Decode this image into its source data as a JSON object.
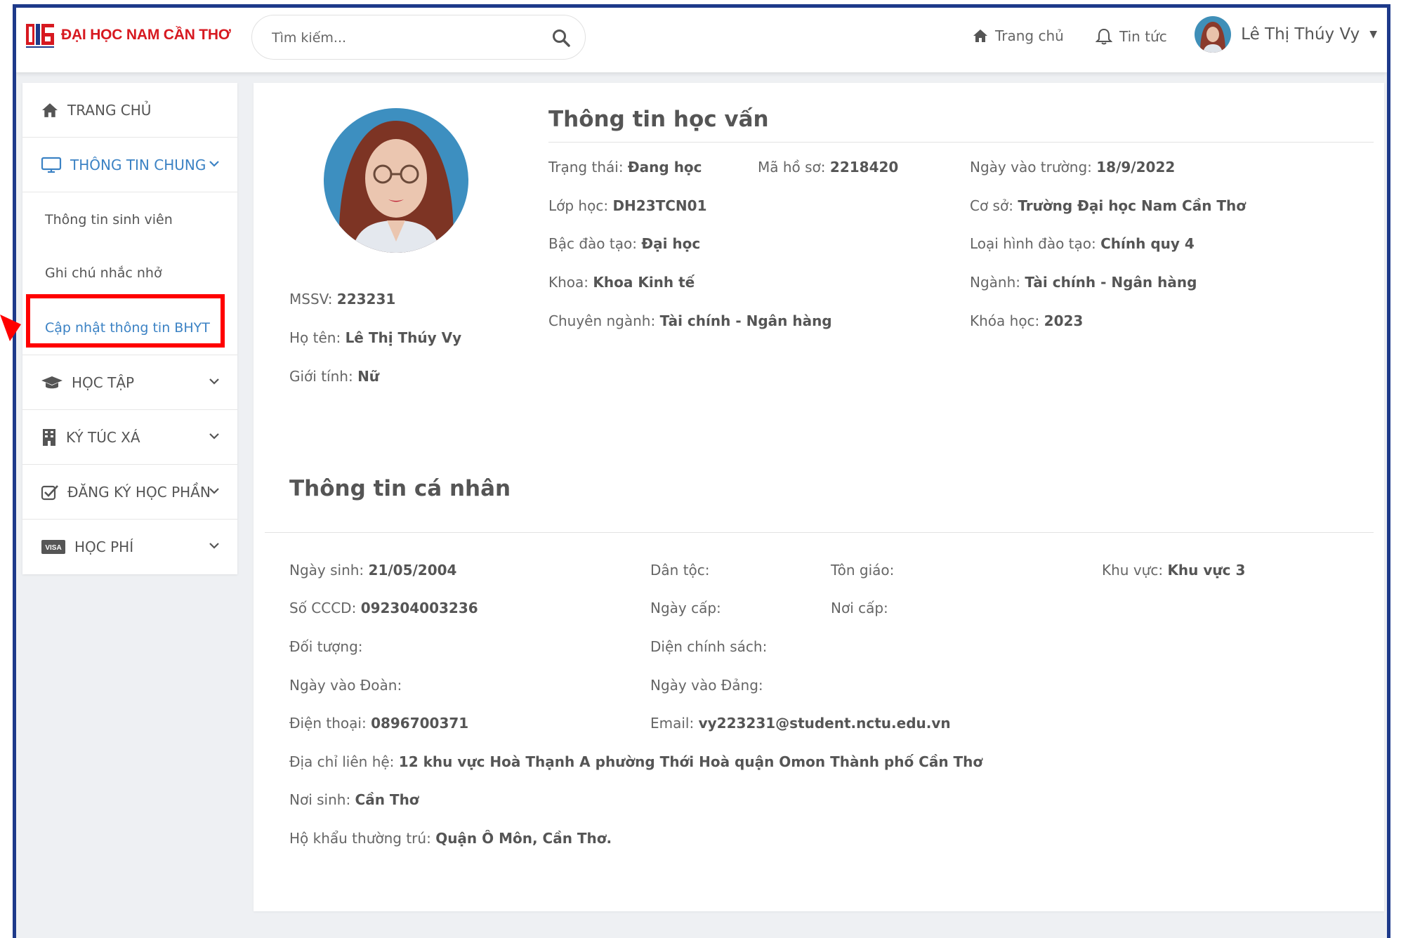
{
  "header": {
    "logo_text": "ĐẠI HỌC NAM CẦN THƠ",
    "search_placeholder": "Tìm kiếm...",
    "nav_home": "Trang chủ",
    "nav_news": "Tin tức",
    "user_name": "Lê Thị Thúy Vy"
  },
  "sidebar": {
    "home": "TRANG CHỦ",
    "general": "THÔNG TIN CHUNG",
    "sub_student_info": "Thông tin sinh viên",
    "sub_notes": "Ghi chú nhắc nhở",
    "sub_bhyt": "Cập nhật thông tin BHYT",
    "study": "HỌC TẬP",
    "dorm": "KÝ TÚC XÁ",
    "registration": "ĐĂNG KÝ HỌC PHẦN",
    "fees": "HỌC PHÍ"
  },
  "academic": {
    "title": "Thông tin học vấn",
    "status_label": "Trạng thái:",
    "status": "Đang học",
    "record_label": "Mã hồ sơ:",
    "record": "2218420",
    "enroll_label": "Ngày vào trường:",
    "enroll": "18/9/2022",
    "class_label": "Lớp học:",
    "class": "DH23TCN01",
    "campus_label": "Cơ sở:",
    "campus": "Trường Đại học Nam Cần Thơ",
    "level_label": "Bậc đào tạo:",
    "level": "Đại học",
    "type_label": "Loại hình đào tạo:",
    "type": "Chính quy 4",
    "faculty_label": "Khoa:",
    "faculty": "Khoa Kinh tế",
    "major_label": "Ngành:",
    "major": "Tài chính - Ngân hàng",
    "spec_label": "Chuyên ngành:",
    "spec": "Tài chính - Ngân hàng",
    "course_label": "Khóa học:",
    "course": "2023",
    "mssv_label": "MSSV:",
    "mssv": "223231",
    "name_label": "Họ tên:",
    "name": "Lê Thị Thúy Vy",
    "gender_label": "Giới tính:",
    "gender": "Nữ"
  },
  "personal": {
    "title": "Thông tin cá nhân",
    "dob_label": "Ngày sinh:",
    "dob": "21/05/2004",
    "ethnic_label": "Dân tộc:",
    "religion_label": "Tôn giáo:",
    "region_label": "Khu vực:",
    "region": "Khu vực 3",
    "cccd_label": "Số CCCD:",
    "cccd": "092304003236",
    "issue_date_label": "Ngày cấp:",
    "issue_place_label": "Nơi cấp:",
    "object_label": "Đối tượng:",
    "policy_label": "Diện chính sách:",
    "union_label": "Ngày vào Đoàn:",
    "party_label": "Ngày vào Đảng:",
    "phone_label": "Điện thoại:",
    "phone": "0896700371",
    "email_label": "Email:",
    "email": "vy223231@student.nctu.edu.vn",
    "address_label": "Địa chỉ liên hệ:",
    "address": "12 khu vực Hoà Thạnh A phường Thới Hoà quận Omon Thành phố Cần Thơ",
    "birthplace_label": "Nơi sinh:",
    "birthplace": "Cần Thơ",
    "residence_label": "Hộ khẩu thường trú:",
    "residence": "Quận Ô Môn, Cần Thơ."
  },
  "colors": {
    "accent": "#3b82c4",
    "brand_red": "#d71920",
    "frame_border": "#1e3a8a",
    "highlight": "#ff0000"
  }
}
